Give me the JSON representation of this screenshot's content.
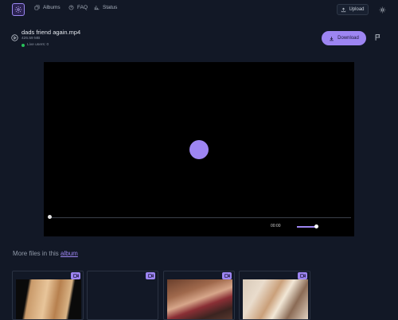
{
  "nav": {
    "albums_label": "Albums",
    "faq_label": "FAQ",
    "status_label": "Status",
    "upload_label": "Upload"
  },
  "file": {
    "title": "dads friend again.mp4",
    "size": "426.59 MB",
    "live_users": "Live users: 0"
  },
  "actions": {
    "download_label": "Download"
  },
  "player": {
    "time": "00:00",
    "progress": 0,
    "volume": 0.9
  },
  "more_files": {
    "prefix": "More files in this",
    "link_label": "album"
  },
  "colors": {
    "accent": "#9d85f2",
    "background": "#121826",
    "live_dot": "#27c25a"
  },
  "icons": {
    "logo": "gear-icon",
    "albums": "albums-icon",
    "faq": "help-icon",
    "status": "chart-icon",
    "upload": "upload-icon",
    "theme": "sun-icon",
    "play": "play-circle-icon",
    "download": "download-icon",
    "report": "flag-icon",
    "video_badge": "video-camera-icon"
  }
}
